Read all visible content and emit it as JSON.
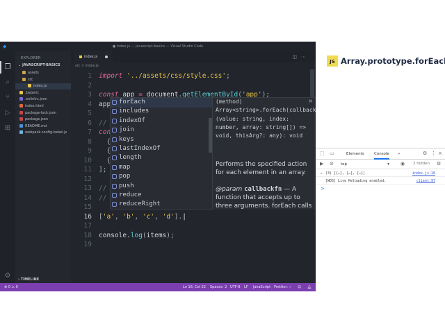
{
  "window": {
    "title": "● index.js — javascript-basics — Visual Studio Code"
  },
  "colors": {
    "accent": "#7b3fb0",
    "status_bar": "#7b3fb0",
    "js_badge": "#f0db4f"
  },
  "sidebar": {
    "header": "EXPLORER",
    "section": "JAVASCRIPT-BASICS",
    "items": [
      {
        "label": "assets",
        "icon": "folder-icon"
      },
      {
        "label": "src",
        "icon": "folder-icon"
      },
      {
        "label": "index.js",
        "icon": "js-file-icon"
      },
      {
        "label": ".babelrc",
        "icon": "babel-icon"
      },
      {
        "label": ".eslintrc.json",
        "icon": "eslint-icon"
      },
      {
        "label": "index.html",
        "icon": "html-file-icon"
      },
      {
        "label": "package-lock.json",
        "icon": "npm-icon"
      },
      {
        "label": "package.json",
        "icon": "npm-icon"
      },
      {
        "label": "README.md",
        "icon": "info-icon"
      },
      {
        "label": "webpack.config.babel.js",
        "icon": "webpack-icon"
      }
    ],
    "timeline": "TIMELINE"
  },
  "tab": {
    "label": "index.js"
  },
  "breadcrumb": {
    "folder": "src",
    "sep": ">",
    "file": "index.js"
  },
  "editor": {
    "lines": [
      {
        "n": "1",
        "tokens": [
          [
            "k",
            "import"
          ],
          [
            "p",
            " "
          ],
          [
            "s",
            "'../assets/css/style.css'"
          ],
          [
            "p",
            ";"
          ]
        ]
      },
      {
        "n": "2",
        "tokens": []
      },
      {
        "n": "3",
        "tokens": [
          [
            "k",
            "const"
          ],
          [
            "v",
            " app "
          ],
          [
            "o",
            "="
          ],
          [
            "v",
            " document."
          ],
          [
            "f",
            "getElementById"
          ],
          [
            "p",
            "("
          ],
          [
            "s",
            "'app'"
          ],
          [
            "p",
            ");"
          ]
        ]
      },
      {
        "n": "4",
        "tokens": [
          [
            "v",
            "app"
          ]
        ]
      },
      {
        "n": "5",
        "tokens": []
      },
      {
        "n": "6",
        "tokens": [
          [
            "c",
            "//"
          ]
        ]
      },
      {
        "n": "7",
        "tokens": [
          [
            "k",
            "con"
          ]
        ]
      },
      {
        "n": "8",
        "tokens": [
          [
            "p",
            "  {"
          ]
        ]
      },
      {
        "n": "9",
        "tokens": [
          [
            "p",
            "  {"
          ]
        ]
      },
      {
        "n": "10",
        "tokens": [
          [
            "p",
            "  {"
          ]
        ]
      },
      {
        "n": "11",
        "tokens": [
          [
            "p",
            "];"
          ]
        ]
      },
      {
        "n": "12",
        "tokens": []
      },
      {
        "n": "13",
        "tokens": [
          [
            "c",
            "//"
          ]
        ]
      },
      {
        "n": "14",
        "tokens": [
          [
            "c",
            "//"
          ]
        ]
      },
      {
        "n": "15",
        "tokens": []
      },
      {
        "n": "16",
        "tokens": [
          [
            "p",
            "["
          ],
          [
            "s",
            "'a'"
          ],
          [
            "p",
            ", "
          ],
          [
            "s",
            "'b'"
          ],
          [
            "p",
            ", "
          ],
          [
            "s",
            "'c'"
          ],
          [
            "p",
            ", "
          ],
          [
            "s",
            "'d'"
          ],
          [
            "p",
            "]."
          ]
        ]
      },
      {
        "n": "17",
        "tokens": []
      },
      {
        "n": "18",
        "tokens": [
          [
            "v",
            "console."
          ],
          [
            "f",
            "log"
          ],
          [
            "p",
            "("
          ],
          [
            "v",
            "items"
          ],
          [
            "p",
            ");"
          ]
        ]
      },
      {
        "n": "19",
        "tokens": []
      }
    ]
  },
  "suggest": {
    "items": [
      "forEach",
      "includes",
      "indexOf",
      "join",
      "keys",
      "lastIndexOf",
      "length",
      "map",
      "pop",
      "push",
      "reduce",
      "reduceRight"
    ],
    "selected": 0,
    "signature": "(method) Array<string>.forEach(callbackfn: (value: string, index: number, array: string[]) => void, thisArg?: any): void",
    "close": "×",
    "description": "Performs the specified action for each element in an array.",
    "param_tag": "@param",
    "param_name": "callbackfn",
    "param_desc": "— A function that accepts up to three arguments. forEach calls the"
  },
  "status": {
    "errors": "⊗ 0 ⚠ 0",
    "position": "Ln 16, Col 22",
    "spaces": "Spaces: 2",
    "encoding": "UTF-8",
    "eol": "LF",
    "language": "JavaScript",
    "formatter": "Prettier: ✓"
  },
  "topic": {
    "badge": "JS",
    "title": "Array.prototype.forEach()"
  },
  "devtools": {
    "tabs": [
      "Elements",
      "Console"
    ],
    "active_tab": "Console",
    "more": "»",
    "context": "top",
    "hidden_count": "2 hidden",
    "logs": [
      {
        "msg": "(3) [{…}, {…}, {…}]",
        "src": "index.js:16"
      },
      {
        "msg": "[WDS] Live Reloading enabled.",
        "src": "client:97"
      }
    ],
    "prompt": ">"
  }
}
